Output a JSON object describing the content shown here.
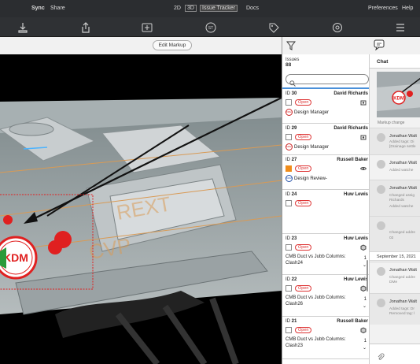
{
  "menubar": {
    "sync": "Sync",
    "share": "Share",
    "view_2d": "2D",
    "view_3d": "3D",
    "issue_tracker": "Issue Tracker",
    "docs": "Docs",
    "preferences": "Preferences",
    "help": "Help"
  },
  "toolbar": {
    "icons": [
      "download-icon",
      "share-icon",
      "add-markup-icon",
      "st-icon",
      "tag-icon",
      "settings-badge-icon",
      "list-icon"
    ],
    "st_label": "ST"
  },
  "viewport": {
    "edit_markup": "Edit Markup",
    "markup_stamp": "KDM",
    "watermark_1": "REXT",
    "watermark_2": "CVP"
  },
  "issues": {
    "header": "Issues",
    "count": "88",
    "search_placeholder": "",
    "items": [
      {
        "id_prefix": "ID",
        "id": "30",
        "author": "David Richards",
        "status": "Open",
        "assignee_badge": "DMe",
        "assignee": "Design Manager",
        "selected": true,
        "check": "white"
      },
      {
        "id_prefix": "ID",
        "id": "29",
        "author": "David Richards",
        "status": "Open",
        "assignee_badge": "DMe",
        "assignee": "Design Manager",
        "selected": false,
        "check": "white"
      },
      {
        "id_prefix": "ID",
        "id": "27",
        "author": "Russell Baker",
        "status": "Open",
        "assignee_badge": "KDM",
        "assignee": "Design Review-",
        "selected": false,
        "check": "orange"
      },
      {
        "id_prefix": "ID",
        "id": "24",
        "author": "Huw Lewis",
        "status": "Open",
        "assignee_badge": "",
        "assignee": "",
        "selected": false,
        "check": "white"
      },
      {
        "id_prefix": "ID",
        "id": "23",
        "author": "Huw Lewis",
        "status": "Open",
        "title": "CMB Duct vs Jubb Columns: Clash24",
        "num": "1",
        "check": "white"
      },
      {
        "id_prefix": "ID",
        "id": "22",
        "author": "Huw Lewis",
        "status": "Open",
        "title": "CMB Duct vs Jubb Columns: Clash26",
        "num": "1",
        "check": "white"
      },
      {
        "id_prefix": "ID",
        "id": "21",
        "author": "Russell Baker",
        "status": "Open",
        "title": "CMB Duct vs Jubb Columns: Clash23",
        "num": "1",
        "check": "white"
      }
    ]
  },
  "chat": {
    "header": "Chat",
    "thumb_caption": "Markup change",
    "entries": [
      {
        "name": "Jonathan Walt",
        "lines": [
          "Added tags: Di",
          "[Drainage settle"
        ]
      },
      {
        "name": "Jonathan Walt",
        "lines": [
          "Added watche"
        ]
      },
      {
        "name": "Jonathan Walt",
        "lines": [
          "Changed assig",
          "Richards",
          "Added watche"
        ]
      },
      {
        "name": "",
        "lines": [
          "Changed addre",
          "02"
        ]
      }
    ],
    "date": "September 15, 2021",
    "entries_after": [
      {
        "name": "Jonathan Walt",
        "lines": [
          "Changed addre",
          "DMe"
        ]
      },
      {
        "name": "Jonathan Walt",
        "lines": [
          "Added tags: Dr",
          "Removed tag: l"
        ]
      }
    ]
  },
  "colors": {
    "accent": "#4a90d9",
    "status_open": "#dd3333",
    "markup_red": "#e02020",
    "check_orange": "#f08c1a"
  }
}
